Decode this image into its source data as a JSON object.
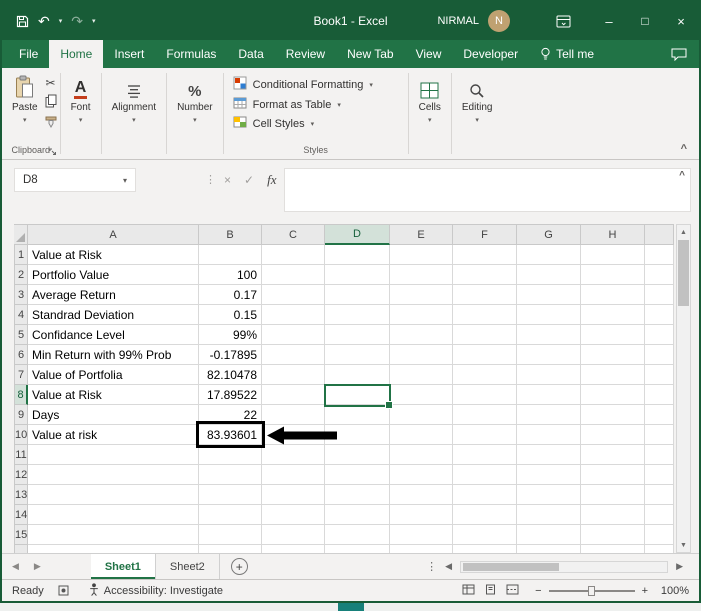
{
  "window": {
    "title": "Book1 - Excel",
    "user_name": "NIRMAL",
    "avatar_letter": "N"
  },
  "icons": {
    "undo": "↶",
    "redo": "↷",
    "dropdown": "▾",
    "minimize": "–",
    "maximize": "□",
    "close": "×",
    "cut": "✂",
    "percent": "%",
    "cancel": "×",
    "enter": "✓",
    "fx": "fx",
    "dots": "⋮",
    "left": "◀",
    "right": "▶",
    "up": "▲",
    "down": "▼",
    "plus": "+",
    "minus": "−",
    "collapse": "^"
  },
  "tabs": {
    "items": [
      {
        "label": "File"
      },
      {
        "label": "Home"
      },
      {
        "label": "Insert"
      },
      {
        "label": "Formulas"
      },
      {
        "label": "Data"
      },
      {
        "label": "Review"
      },
      {
        "label": "New Tab"
      },
      {
        "label": "View"
      },
      {
        "label": "Developer"
      },
      {
        "label": "Tell me"
      }
    ]
  },
  "ribbon": {
    "paste": "Paste",
    "clipboard": "Clipboard",
    "font": "Font",
    "alignment": "Alignment",
    "number": "Number",
    "conditional_formatting": "Conditional Formatting",
    "format_as_table": "Format as Table",
    "cell_styles": "Cell Styles",
    "styles": "Styles",
    "cells": "Cells",
    "editing": "Editing"
  },
  "formula_bar": {
    "name_box": "D8",
    "formula": ""
  },
  "grid": {
    "column_headers": [
      "A",
      "B",
      "C",
      "D",
      "E",
      "F",
      "G",
      "H"
    ],
    "active_cell": "D8",
    "rows": [
      {
        "n": "1",
        "A": "Value at Risk",
        "B": ""
      },
      {
        "n": "2",
        "A": "Portfolio Value",
        "B": "100"
      },
      {
        "n": "3",
        "A": "Average Return",
        "B": "0.17"
      },
      {
        "n": "4",
        "A": "Standrad Deviation",
        "B": "0.15"
      },
      {
        "n": "5",
        "A": "Confidance Level",
        "B": "99%"
      },
      {
        "n": "6",
        "A": "Min Return with 99% Prob",
        "B": "-0.17895"
      },
      {
        "n": "7",
        "A": "Value of Portfolia",
        "B": "82.10478"
      },
      {
        "n": "8",
        "A": "Value at Risk",
        "B": "17.89522"
      },
      {
        "n": "9",
        "A": "Days",
        "B": "22"
      },
      {
        "n": "10",
        "A": "Value at risk",
        "B": "83.93601"
      },
      {
        "n": "11",
        "A": "",
        "B": ""
      },
      {
        "n": "12",
        "A": "",
        "B": ""
      },
      {
        "n": "13",
        "A": "",
        "B": ""
      },
      {
        "n": "14",
        "A": "",
        "B": ""
      },
      {
        "n": "15",
        "A": "",
        "B": ""
      }
    ]
  },
  "sheets": {
    "tab1": "Sheet1",
    "tab2": "Sheet2"
  },
  "status": {
    "mode": "Ready",
    "accessibility": "Accessibility: Investigate",
    "zoom": "100%"
  }
}
